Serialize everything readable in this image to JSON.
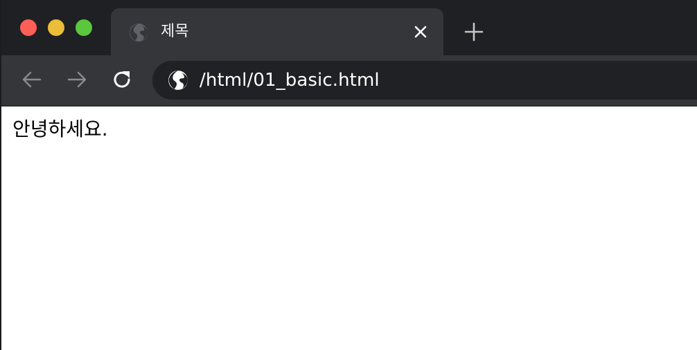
{
  "colors": {
    "close": "#ff5f57",
    "minimize": "#ebbd38",
    "maximize": "#5ac73e",
    "tabstrip_bg": "#1f2023",
    "active_tab_bg": "#35363a",
    "omnibox_bg": "#202124"
  },
  "tabs": [
    {
      "title": "제목",
      "favicon": "globe-icon",
      "active": true
    }
  ],
  "toolbar": {
    "back_icon": "arrow-left-icon",
    "forward_icon": "arrow-right-icon",
    "reload_icon": "reload-icon",
    "new_tab_icon": "plus-icon"
  },
  "omnibox": {
    "icon": "globe-icon",
    "url": "/html/01_basic.html"
  },
  "page": {
    "text": "안녕하세요."
  }
}
